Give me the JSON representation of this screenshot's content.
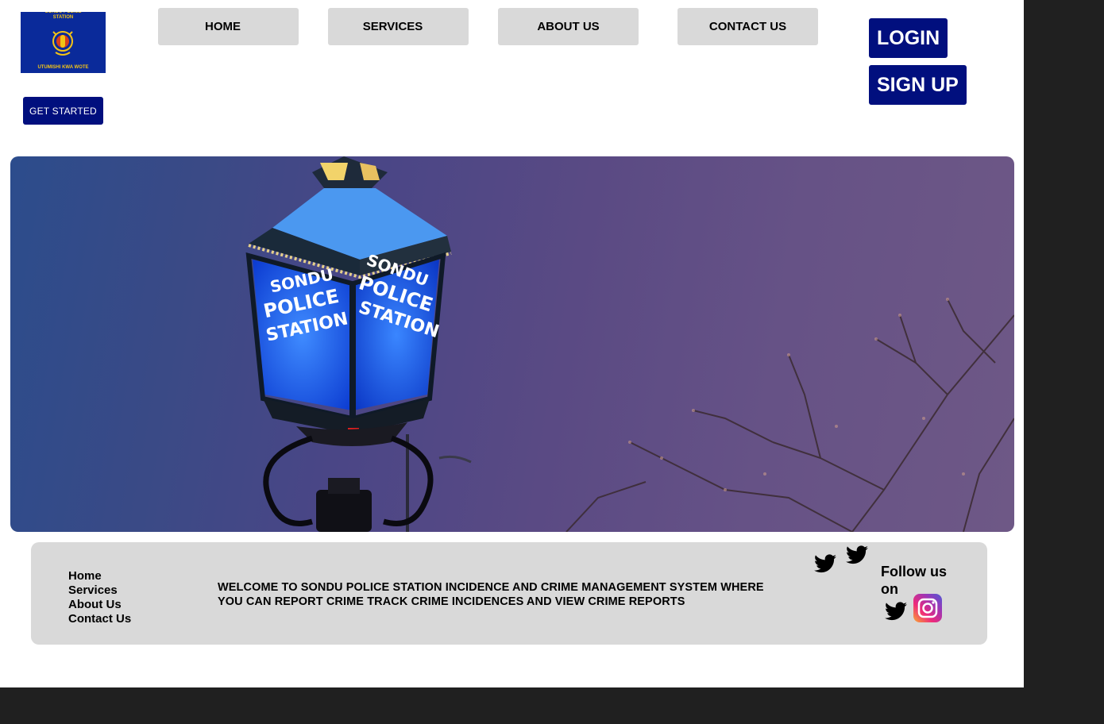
{
  "logo": {
    "top_text": "SONDU POLICE STATION",
    "motto": "UTUMISHI KWA WOTE"
  },
  "get_started_label": "GET STARTED",
  "nav": {
    "home": "HOME",
    "services": "SERVICES",
    "about": "ABOUT US",
    "contact": "CONTACT US"
  },
  "auth": {
    "login": "LOGIN",
    "signup": "SIGN UP"
  },
  "hero": {
    "lamp_text_left": [
      "SONDU",
      "POLICE",
      "STATION"
    ],
    "lamp_text_right": [
      "SONDU",
      "POLICE",
      "STATION"
    ]
  },
  "footer": {
    "links": [
      "Home",
      "Services",
      "About Us",
      "Contact Us"
    ],
    "welcome": "WELCOME TO SONDU POLICE STATION INCIDENCE AND CRIME MANAGEMENT SYSTEM WHERE YOU CAN REPORT CRIME TRACK CRIME INCIDENCES AND VIEW CRIME REPORTS",
    "follow": "Follow us on"
  },
  "colors": {
    "primary_blue": "#010f7e",
    "nav_gray": "#d9d9d9",
    "backdrop": "#202020"
  },
  "icons": [
    "police-crest-icon",
    "twitter-icon",
    "instagram-icon"
  ]
}
